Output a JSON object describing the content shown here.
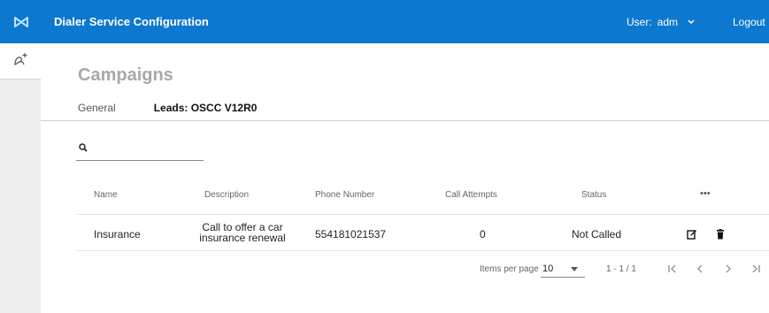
{
  "app": {
    "title": "Dialer Service Configuration"
  },
  "user": {
    "label": "User:",
    "name": "adm",
    "logout": "Logout"
  },
  "page": {
    "title": "Campaigns"
  },
  "tabs": [
    {
      "label": "General"
    },
    {
      "label": "Leads: OSCC V12R0"
    }
  ],
  "search": {
    "value": "",
    "placeholder": ""
  },
  "table": {
    "columns": [
      "Name",
      "Description",
      "Phone Number",
      "Call Attempts",
      "Status",
      "•••"
    ],
    "rows": [
      {
        "name": "Insurance",
        "description": "Call to offer a car insurance renewal",
        "phone": "554181021537",
        "attempts": "0",
        "status": "Not Called"
      }
    ]
  },
  "pagination": {
    "items_per_page_label": "Items per page",
    "items_per_page": "10",
    "range": "1 - 1 / 1"
  },
  "colors": {
    "topbar": "#0d78cf",
    "sidebar": "#eeeeee",
    "title": "#a8a8a8"
  },
  "icons": [
    "logo-icon",
    "add-contact-icon",
    "chevron-down-icon",
    "search-icon",
    "edit-icon",
    "trash-icon",
    "first-page-icon",
    "prev-page-icon",
    "next-page-icon",
    "last-page-icon"
  ]
}
